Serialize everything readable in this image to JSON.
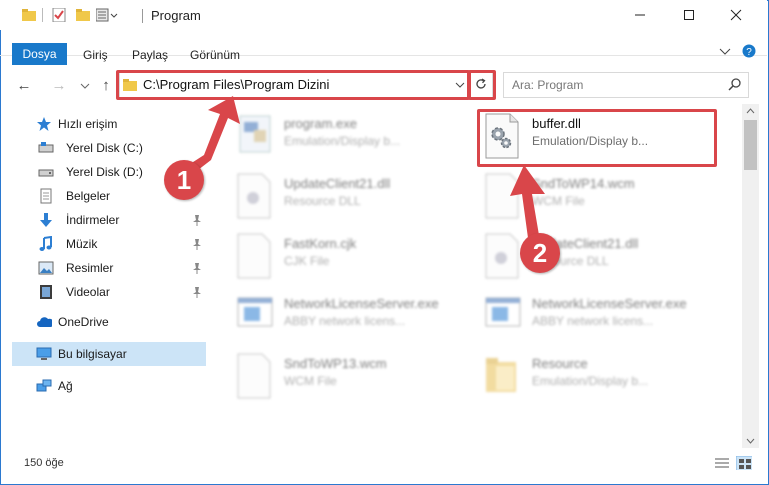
{
  "window": {
    "title": "Program",
    "controls": [
      "minimize",
      "maximize",
      "close"
    ]
  },
  "ribbon": {
    "tabs": [
      "Dosya",
      "Giriş",
      "Paylaş",
      "Görünüm"
    ]
  },
  "address": {
    "path": "C:\\Program Files\\Program Dizini",
    "search_placeholder": "Ara: Program"
  },
  "sidebar": {
    "quick_access": "Hızlı erişim",
    "items": [
      {
        "label": "Yerel Disk (C:)",
        "icon": "drive-icon",
        "pinned": false
      },
      {
        "label": "Yerel Disk (D:)",
        "icon": "drive-icon",
        "pinned": false
      },
      {
        "label": "Belgeler",
        "icon": "documents-icon",
        "pinned": false
      },
      {
        "label": "İndirmeler",
        "icon": "download-icon",
        "pinned": true
      },
      {
        "label": "Müzik",
        "icon": "music-icon",
        "pinned": true
      },
      {
        "label": "Resimler",
        "icon": "pictures-icon",
        "pinned": true
      },
      {
        "label": "Videolar",
        "icon": "videos-icon",
        "pinned": true
      }
    ],
    "onedrive": "OneDrive",
    "this_pc": "Bu bilgisayar",
    "network": "Ağ"
  },
  "files": [
    {
      "name": "program.exe",
      "type": "Emulation/Display b...",
      "icon": "exe-icon"
    },
    {
      "name": "buffer.dll",
      "type": "Emulation/Display b...",
      "icon": "dll-gear-icon"
    },
    {
      "name": "UpdateClient21.dll",
      "type": "Resource DLL",
      "icon": "dll-icon"
    },
    {
      "name": "SndToWP14.wcm",
      "type": "WCM File",
      "icon": "file-icon"
    },
    {
      "name": "FastKorn.cjk",
      "type": "CJK File",
      "icon": "file-icon"
    },
    {
      "name": "UpdateClient21.dll",
      "type": "Resource DLL",
      "icon": "dll-icon"
    },
    {
      "name": "NetworkLicenseServer.exe",
      "type": "ABBY network licens...",
      "icon": "app-window-icon"
    },
    {
      "name": "NetworkLicenseServer.exe",
      "type": "ABBY network licens...",
      "icon": "app-window-icon"
    },
    {
      "name": "SndToWP13.wcm",
      "type": "WCM File",
      "icon": "file-icon"
    },
    {
      "name": "Resource",
      "type": "Emulation/Display b...",
      "icon": "folder-icon"
    }
  ],
  "status": {
    "item_count": "150 öğe"
  },
  "callouts": [
    "1",
    "2"
  ],
  "colors": {
    "accent": "#1979ca",
    "highlight": "#d9464a",
    "selected": "#cce4f7"
  }
}
